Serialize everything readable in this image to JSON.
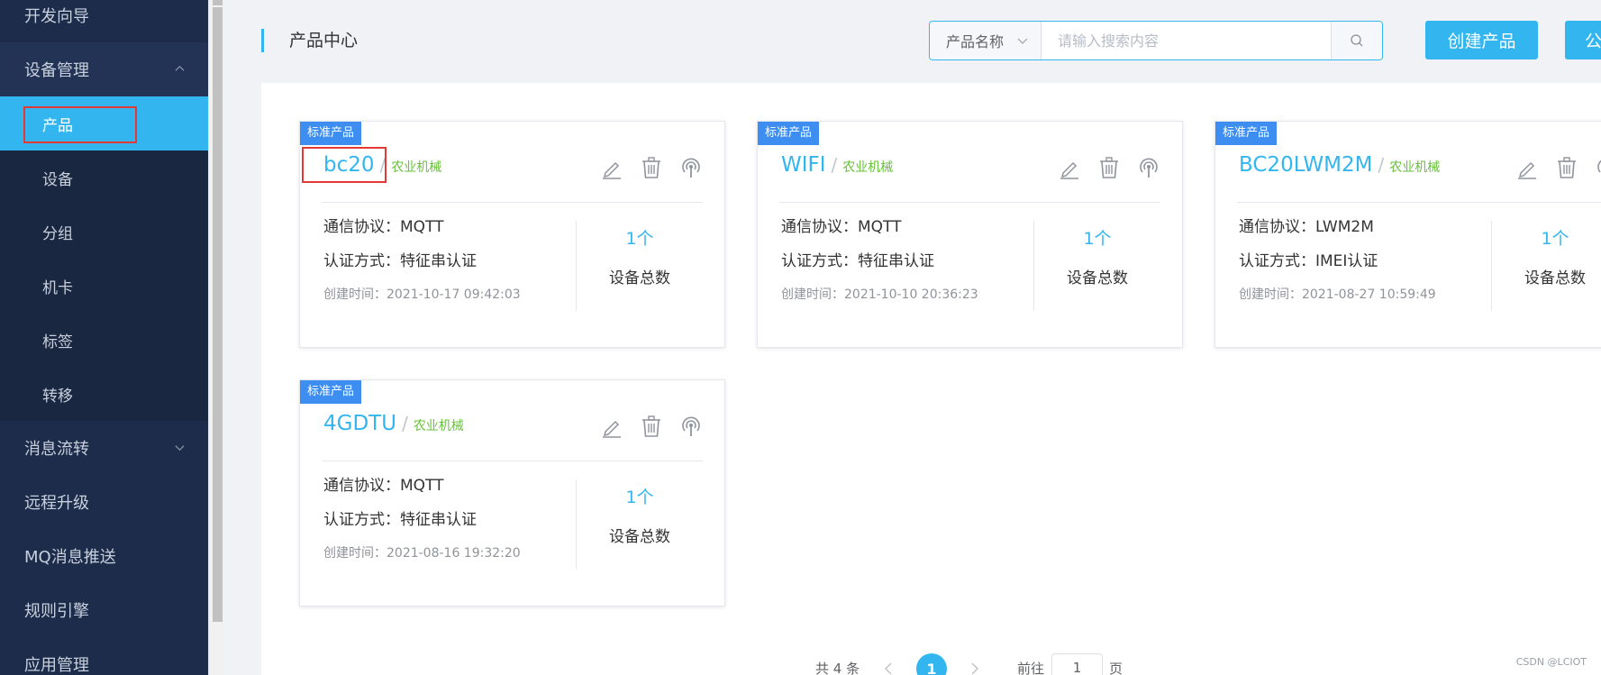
{
  "sidebar": {
    "items": [
      {
        "label": "开发向导"
      },
      {
        "label": "设备管理"
      },
      {
        "label": "产品"
      },
      {
        "label": "设备"
      },
      {
        "label": "分组"
      },
      {
        "label": "机卡"
      },
      {
        "label": "标签"
      },
      {
        "label": "转移"
      },
      {
        "label": "消息流转"
      },
      {
        "label": "远程升级"
      },
      {
        "label": "MQ消息推送"
      },
      {
        "label": "规则引擎"
      },
      {
        "label": "应用管理"
      }
    ],
    "active_item": "产品",
    "expanded_group": "设备管理"
  },
  "header": {
    "title": "产品中心",
    "search": {
      "field_label": "产品名称",
      "placeholder": "请输入搜索内容",
      "value": ""
    },
    "create_button": "创建产品",
    "second_button": "公"
  },
  "cards": [
    {
      "tag": "标准产品",
      "name": "bc20",
      "separator": "/",
      "category": "农业机械",
      "protocol": "通信协议：MQTT",
      "auth": "认证方式：特征串认证",
      "created": "创建时间：2021-10-17 09:42:03",
      "device_count": "1个",
      "device_count_label": "设备总数"
    },
    {
      "tag": "标准产品",
      "name": "WIFI",
      "separator": "/",
      "category": "农业机械",
      "protocol": "通信协议：MQTT",
      "auth": "认证方式：特征串认证",
      "created": "创建时间：2021-10-10 20:36:23",
      "device_count": "1个",
      "device_count_label": "设备总数"
    },
    {
      "tag": "标准产品",
      "name": "BC20LWM2M",
      "separator": "/",
      "category": "农业机械",
      "protocol": "通信协议：LWM2M",
      "auth": "认证方式：IMEI认证",
      "created": "创建时间：2021-08-27 10:59:49",
      "device_count": "1个",
      "device_count_label": "设备总数"
    },
    {
      "tag": "标准产品",
      "name": "4GDTU",
      "separator": "/",
      "category": "农业机械",
      "protocol": "通信协议：MQTT",
      "auth": "认证方式：特征串认证",
      "created": "创建时间：2021-08-16 19:32:20",
      "device_count": "1个",
      "device_count_label": "设备总数"
    }
  ],
  "pagination": {
    "total": "共 4 条",
    "current_page": "1",
    "goto_label": "前往",
    "goto_value": "1",
    "page_suffix": "页"
  },
  "watermark": "CSDN @LCIOT",
  "colors": {
    "sidebar_bg": "#1d2c4a",
    "accent": "#33b6ef",
    "tag_bg": "#3d8ef0",
    "category_green": "#67c23a",
    "highlight_red": "#e53935"
  }
}
